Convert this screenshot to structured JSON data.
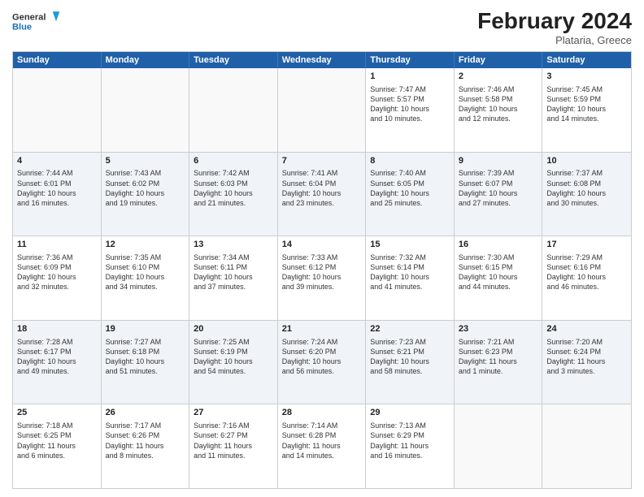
{
  "app": {
    "title": "February 2024",
    "subtitle": "Plataria, Greece"
  },
  "logo": {
    "line1": "General",
    "line2": "Blue"
  },
  "headers": [
    "Sunday",
    "Monday",
    "Tuesday",
    "Wednesday",
    "Thursday",
    "Friday",
    "Saturday"
  ],
  "weeks": [
    [
      {
        "day": "",
        "content": ""
      },
      {
        "day": "",
        "content": ""
      },
      {
        "day": "",
        "content": ""
      },
      {
        "day": "",
        "content": ""
      },
      {
        "day": "1",
        "content": "Sunrise: 7:47 AM\nSunset: 5:57 PM\nDaylight: 10 hours\nand 10 minutes."
      },
      {
        "day": "2",
        "content": "Sunrise: 7:46 AM\nSunset: 5:58 PM\nDaylight: 10 hours\nand 12 minutes."
      },
      {
        "day": "3",
        "content": "Sunrise: 7:45 AM\nSunset: 5:59 PM\nDaylight: 10 hours\nand 14 minutes."
      }
    ],
    [
      {
        "day": "4",
        "content": "Sunrise: 7:44 AM\nSunset: 6:01 PM\nDaylight: 10 hours\nand 16 minutes."
      },
      {
        "day": "5",
        "content": "Sunrise: 7:43 AM\nSunset: 6:02 PM\nDaylight: 10 hours\nand 19 minutes."
      },
      {
        "day": "6",
        "content": "Sunrise: 7:42 AM\nSunset: 6:03 PM\nDaylight: 10 hours\nand 21 minutes."
      },
      {
        "day": "7",
        "content": "Sunrise: 7:41 AM\nSunset: 6:04 PM\nDaylight: 10 hours\nand 23 minutes."
      },
      {
        "day": "8",
        "content": "Sunrise: 7:40 AM\nSunset: 6:05 PM\nDaylight: 10 hours\nand 25 minutes."
      },
      {
        "day": "9",
        "content": "Sunrise: 7:39 AM\nSunset: 6:07 PM\nDaylight: 10 hours\nand 27 minutes."
      },
      {
        "day": "10",
        "content": "Sunrise: 7:37 AM\nSunset: 6:08 PM\nDaylight: 10 hours\nand 30 minutes."
      }
    ],
    [
      {
        "day": "11",
        "content": "Sunrise: 7:36 AM\nSunset: 6:09 PM\nDaylight: 10 hours\nand 32 minutes."
      },
      {
        "day": "12",
        "content": "Sunrise: 7:35 AM\nSunset: 6:10 PM\nDaylight: 10 hours\nand 34 minutes."
      },
      {
        "day": "13",
        "content": "Sunrise: 7:34 AM\nSunset: 6:11 PM\nDaylight: 10 hours\nand 37 minutes."
      },
      {
        "day": "14",
        "content": "Sunrise: 7:33 AM\nSunset: 6:12 PM\nDaylight: 10 hours\nand 39 minutes."
      },
      {
        "day": "15",
        "content": "Sunrise: 7:32 AM\nSunset: 6:14 PM\nDaylight: 10 hours\nand 41 minutes."
      },
      {
        "day": "16",
        "content": "Sunrise: 7:30 AM\nSunset: 6:15 PM\nDaylight: 10 hours\nand 44 minutes."
      },
      {
        "day": "17",
        "content": "Sunrise: 7:29 AM\nSunset: 6:16 PM\nDaylight: 10 hours\nand 46 minutes."
      }
    ],
    [
      {
        "day": "18",
        "content": "Sunrise: 7:28 AM\nSunset: 6:17 PM\nDaylight: 10 hours\nand 49 minutes."
      },
      {
        "day": "19",
        "content": "Sunrise: 7:27 AM\nSunset: 6:18 PM\nDaylight: 10 hours\nand 51 minutes."
      },
      {
        "day": "20",
        "content": "Sunrise: 7:25 AM\nSunset: 6:19 PM\nDaylight: 10 hours\nand 54 minutes."
      },
      {
        "day": "21",
        "content": "Sunrise: 7:24 AM\nSunset: 6:20 PM\nDaylight: 10 hours\nand 56 minutes."
      },
      {
        "day": "22",
        "content": "Sunrise: 7:23 AM\nSunset: 6:21 PM\nDaylight: 10 hours\nand 58 minutes."
      },
      {
        "day": "23",
        "content": "Sunrise: 7:21 AM\nSunset: 6:23 PM\nDaylight: 11 hours\nand 1 minute."
      },
      {
        "day": "24",
        "content": "Sunrise: 7:20 AM\nSunset: 6:24 PM\nDaylight: 11 hours\nand 3 minutes."
      }
    ],
    [
      {
        "day": "25",
        "content": "Sunrise: 7:18 AM\nSunset: 6:25 PM\nDaylight: 11 hours\nand 6 minutes."
      },
      {
        "day": "26",
        "content": "Sunrise: 7:17 AM\nSunset: 6:26 PM\nDaylight: 11 hours\nand 8 minutes."
      },
      {
        "day": "27",
        "content": "Sunrise: 7:16 AM\nSunset: 6:27 PM\nDaylight: 11 hours\nand 11 minutes."
      },
      {
        "day": "28",
        "content": "Sunrise: 7:14 AM\nSunset: 6:28 PM\nDaylight: 11 hours\nand 14 minutes."
      },
      {
        "day": "29",
        "content": "Sunrise: 7:13 AM\nSunset: 6:29 PM\nDaylight: 11 hours\nand 16 minutes."
      },
      {
        "day": "",
        "content": ""
      },
      {
        "day": "",
        "content": ""
      }
    ]
  ]
}
